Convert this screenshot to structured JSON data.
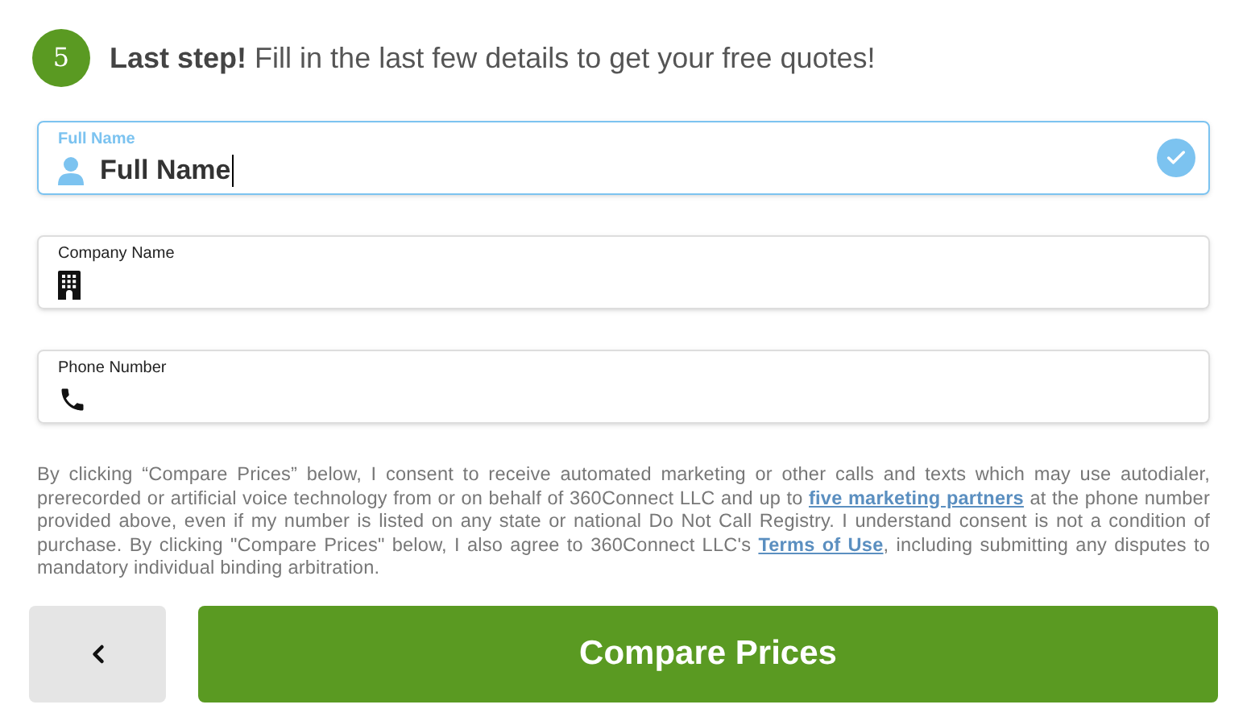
{
  "step": {
    "number": "5",
    "title_bold": "Last step!",
    "title_rest": "Fill in the last few details to get your free quotes!"
  },
  "fields": [
    {
      "kind": "person",
      "label": "Full Name",
      "value": "Full Name",
      "focused": true,
      "valid": true
    },
    {
      "kind": "building",
      "label": "Company Name",
      "focused": false,
      "valid": false
    },
    {
      "kind": "phone",
      "label": "Phone Number",
      "focused": false,
      "valid": false
    }
  ],
  "consent": [
    {
      "kind": "text",
      "text": "By clicking “Compare Prices” below, I consent to receive automated marketing or other calls and texts which may use autodialer, prerecorded or artificial voice technology from or on behalf of 360Connect LLC and up to "
    },
    {
      "kind": "link",
      "text": "five marketing partners"
    },
    {
      "kind": "text",
      "text": " at the phone number provided above, even if my number is listed on any state or national Do Not Call Registry. I understand consent is not a condition of purchase. By clicking \"Compare Prices\" below, I also agree to 360Connect LLC's "
    },
    {
      "kind": "link",
      "text": "Terms of Use"
    },
    {
      "kind": "text",
      "text": ", including submitting any disputes to mandatory individual binding arbitration."
    }
  ],
  "submit": "Compare Prices"
}
